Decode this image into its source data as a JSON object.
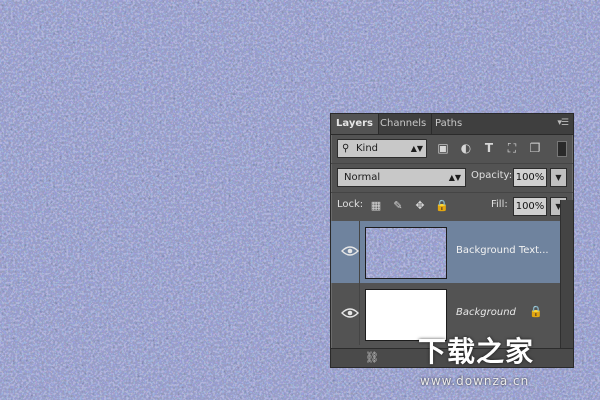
{
  "panel": {
    "tabs": [
      {
        "label": "Layers",
        "active": true
      },
      {
        "label": "Channels",
        "active": false
      },
      {
        "label": "Paths",
        "active": false
      }
    ],
    "filter": {
      "kind_label": "Kind"
    },
    "blend": {
      "mode": "Normal",
      "opacity_label": "Opacity:",
      "opacity_value": "100%"
    },
    "lock": {
      "lock_label": "Lock:",
      "fill_label": "Fill:",
      "fill_value": "100%"
    },
    "layers": [
      {
        "name": "Background Text...",
        "selected": true,
        "visible": true
      },
      {
        "name": "Background",
        "selected": false,
        "visible": true,
        "locked": true
      }
    ]
  },
  "colors": {
    "panel_bg": "#535353",
    "selection": "#6f839e",
    "texture_base": "#3d4457"
  },
  "watermark": {
    "main": "下载之家",
    "url": "www.downza.cn"
  }
}
